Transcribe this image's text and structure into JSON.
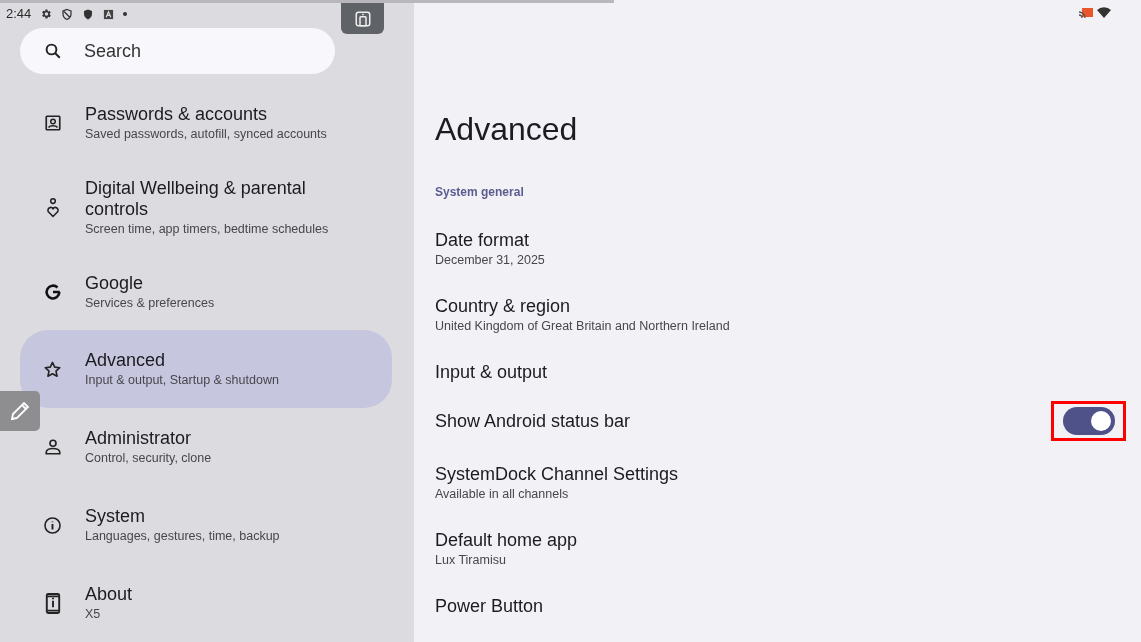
{
  "status_bar": {
    "time": "2:44"
  },
  "search": {
    "placeholder": "Search"
  },
  "sidebar": {
    "items": [
      {
        "kind": "account",
        "title": "Passwords & accounts",
        "subtitle": "Saved passwords, autofill, synced accounts",
        "selected": false
      },
      {
        "kind": "wellbeing",
        "title": "Digital Wellbeing & parental controls",
        "subtitle": "Screen time, app timers, bedtime schedules",
        "selected": false
      },
      {
        "kind": "google",
        "title": "Google",
        "subtitle": "Services & preferences",
        "selected": false
      },
      {
        "kind": "star",
        "title": "Advanced",
        "subtitle": "Input & output, Startup & shutdown",
        "selected": true
      },
      {
        "kind": "person",
        "title": "Administrator",
        "subtitle": "Control, security, clone",
        "selected": false
      },
      {
        "kind": "info",
        "title": "System",
        "subtitle": "Languages, gestures, time, backup",
        "selected": false
      },
      {
        "kind": "phone",
        "title": "About",
        "subtitle": "X5",
        "selected": false
      }
    ]
  },
  "page": {
    "title": "Advanced",
    "section": "System general",
    "rows": [
      {
        "kind": "text",
        "title": "Date format",
        "subtitle": "December 31, 2025"
      },
      {
        "kind": "text",
        "title": "Country & region",
        "subtitle": "United Kingdom of Great Britain and Northern Ireland"
      },
      {
        "kind": "text",
        "title": "Input & output"
      },
      {
        "kind": "switch",
        "title": "Show Android status bar",
        "on": true
      },
      {
        "kind": "text",
        "title": "SystemDock Channel Settings",
        "subtitle": "Available in all channels"
      },
      {
        "kind": "text",
        "title": "Default home app",
        "subtitle": "Lux Tiramisu"
      },
      {
        "kind": "text",
        "title": "Power Button"
      }
    ]
  }
}
